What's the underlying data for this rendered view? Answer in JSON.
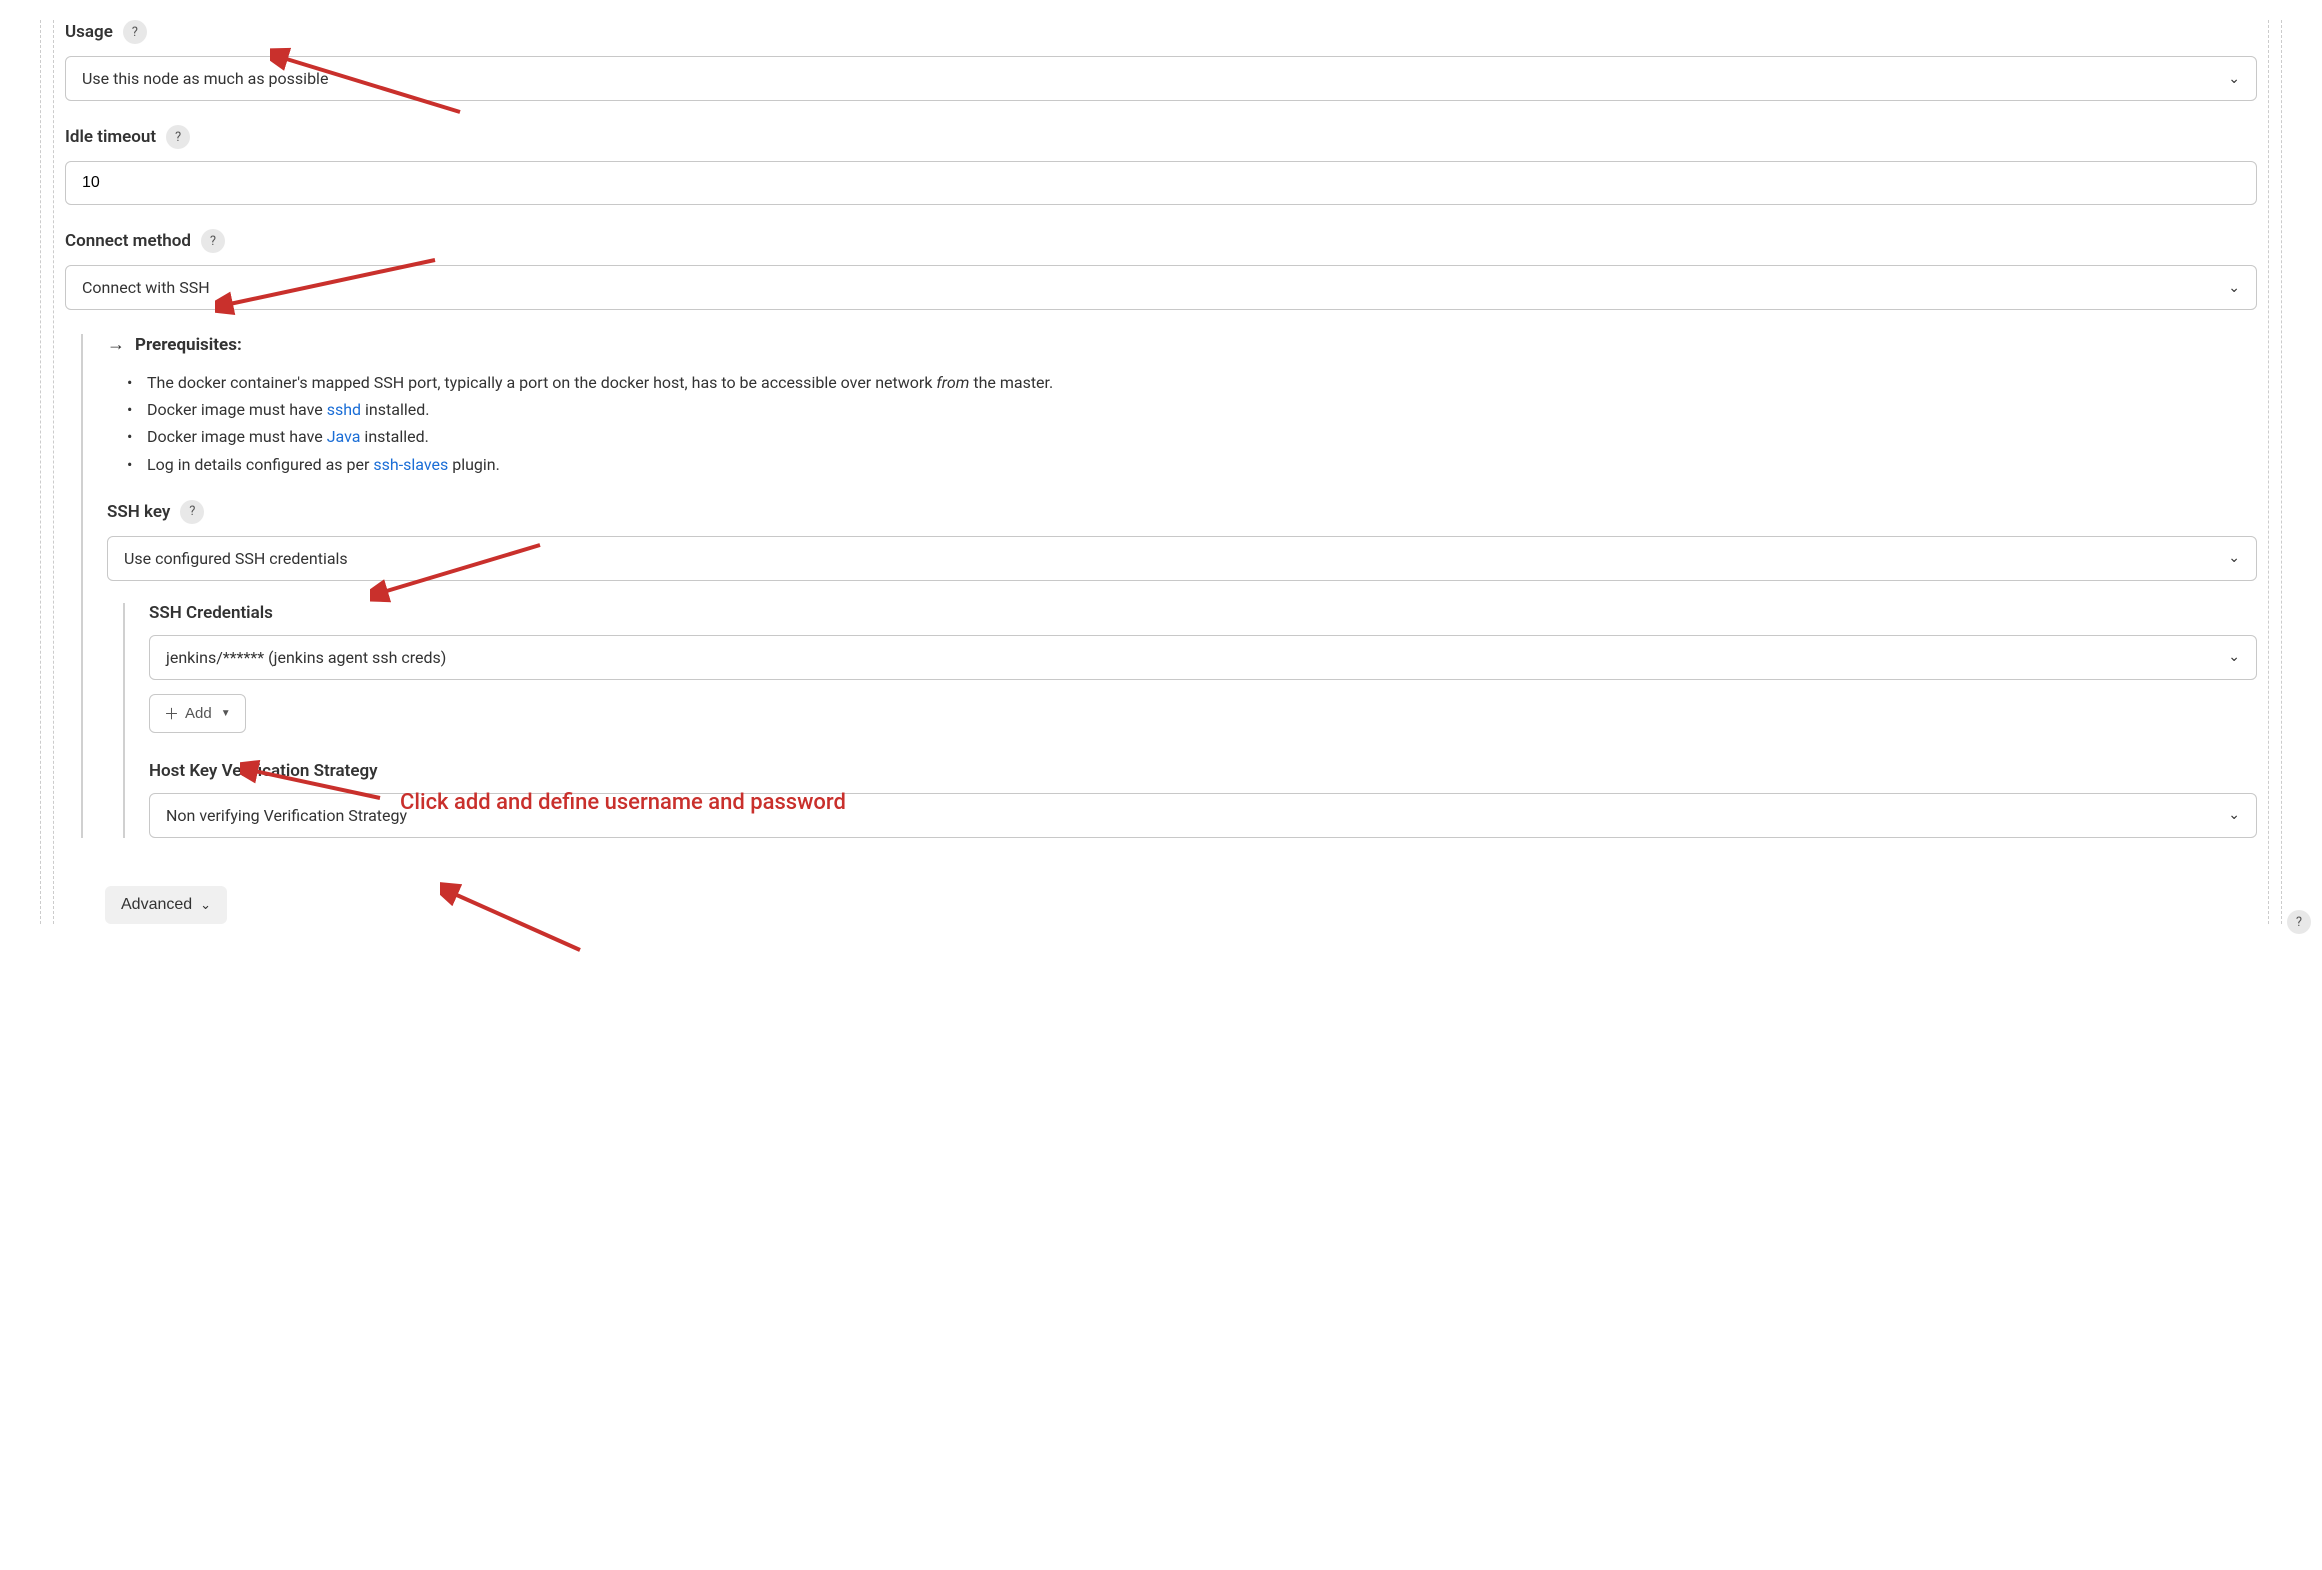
{
  "fields": {
    "usage": {
      "label": "Usage",
      "value": "Use this node as much as possible"
    },
    "idle_timeout": {
      "label": "Idle timeout",
      "value": "10"
    },
    "connect_method": {
      "label": "Connect method",
      "value": "Connect with SSH"
    },
    "prerequisites": {
      "heading": "Prerequisites:",
      "items": [
        {
          "pre": "The docker container's mapped SSH port, typically a port on the docker host, has to be accessible over network ",
          "italic": "from",
          "post": " the master."
        },
        {
          "pre": "Docker image must have ",
          "link": "sshd",
          "post": " installed."
        },
        {
          "pre": "Docker image must have ",
          "link": "Java",
          "post": " installed."
        },
        {
          "pre": "Log in details configured as per ",
          "link": "ssh-slaves",
          "post": " plugin."
        }
      ]
    },
    "ssh_key": {
      "label": "SSH key",
      "value": "Use configured SSH credentials"
    },
    "ssh_credentials": {
      "label": "SSH Credentials",
      "value": "jenkins/****** (jenkins agent ssh creds)",
      "add_label": "Add"
    },
    "host_key": {
      "label": "Host Key Verification Strategy",
      "value": "Non verifying Verification Strategy"
    },
    "advanced_label": "Advanced"
  },
  "annotations": {
    "add_note": "Click add and define username and password"
  },
  "help_char": "?"
}
